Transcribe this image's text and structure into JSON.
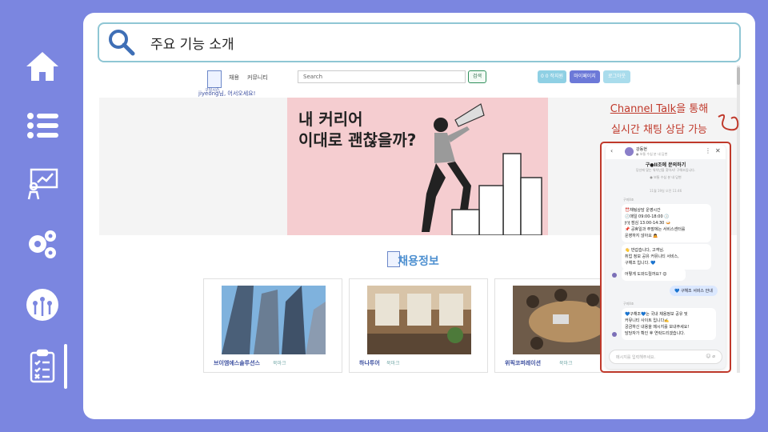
{
  "rail": {
    "items": [
      "home-icon",
      "list-icon",
      "presentation-icon",
      "settings-gears-icon",
      "network-icon",
      "clipboard-checklist-icon"
    ],
    "active": "clipboard-checklist-icon"
  },
  "topbar": {
    "title": "주요 기능 소개"
  },
  "site": {
    "logo_text": "구일시즌",
    "nav": [
      "채용",
      "커뮤니티"
    ],
    "welcome": "jiyeong님, 어서오세요!",
    "search_placeholder": "Search",
    "search_button": "검색",
    "pills": [
      "0 0 작지원",
      "마이페이지",
      "로그아웃"
    ],
    "banner_text_line1": "내 커리어",
    "banner_text_line2": "이대로 괜찮을까?",
    "section_title": "채용정보",
    "jobs": [
      {
        "name": "브이엠에스솔루션스",
        "bookmark": "북마크"
      },
      {
        "name": "하나투어",
        "bookmark": "북마크"
      },
      {
        "name": "위픽코퍼레이션",
        "bookmark": "북마크"
      }
    ]
  },
  "annotation": {
    "brand": "Channel Talk",
    "line1_rest": "을 통해",
    "line2": "실시간 채팅 상담 가능"
  },
  "chat": {
    "header_name": "강동현",
    "header_status": "● 보통 수십 분 내 답변",
    "title": "구●II조에 문의하기",
    "subtitle": "당신에 맞는 워치넌을 찾아서! 구해조입니다.",
    "meta": "● 보통 수십 분 내 답변",
    "date": "11월 19일 오전 11:46",
    "sender1": "구미II조",
    "bubble1": "⏰채팅상담 운영시간\n🕘매일 09:00-18:00 🕕\n🍽 점심 13:00-14:30 🍛\n📌 공휴일과 주말에는 서비스센터를\n운영하지 않아요 🙇",
    "bubble2": "👋 반갑습니다, 고객님.\n취업 정보 공유 커뮤니티 서비스,\n구해조 입니다. 💙",
    "bubble3": "어떻게 도와드릴까요? 😊",
    "my_reply": "💙 구해조 서비스 안내",
    "sender2": "구미II조",
    "bubble4": "💙구해조💙는 국내 채용정보 공유 및\n커뮤니티 사이트 입니다✍️\n궁금하신 내용을 메시지를 보내주세요!\n담당자가 확인 후 연락드리겠습니다.",
    "input_placeholder": "메시지를 입력해주세요."
  },
  "colors": {
    "background": "#7b86e0",
    "accent": "#4c8fd0",
    "annotation": "#c0392b"
  }
}
